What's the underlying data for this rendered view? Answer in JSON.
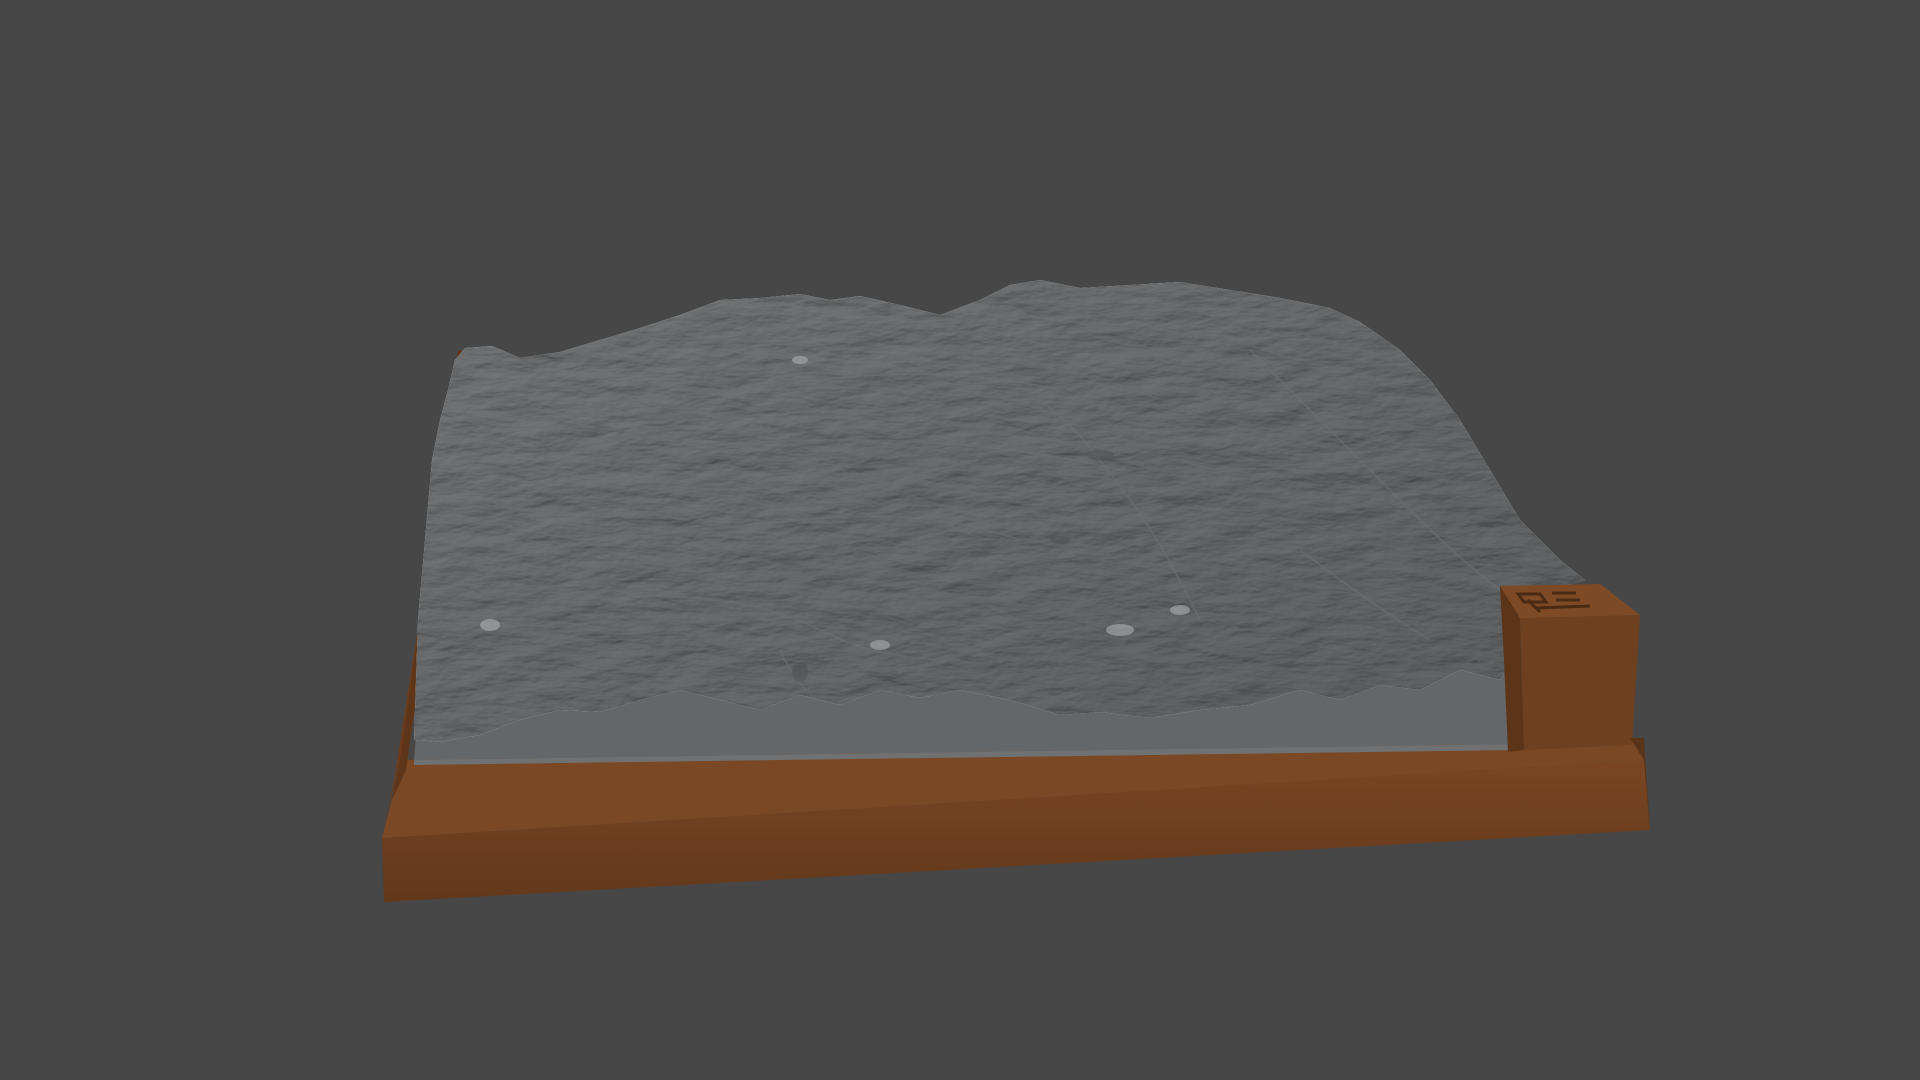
{
  "viewport": {
    "background_color": "#474747",
    "object": "terrain-relief-model"
  },
  "model": {
    "terrain_color": "#8e8f90",
    "terrain_side_color": "#646566",
    "base_color": "#6b3e1f",
    "base_dark_color": "#5a3418",
    "base_top_color": "#7a4824",
    "label_block_color": "#6e401f"
  }
}
